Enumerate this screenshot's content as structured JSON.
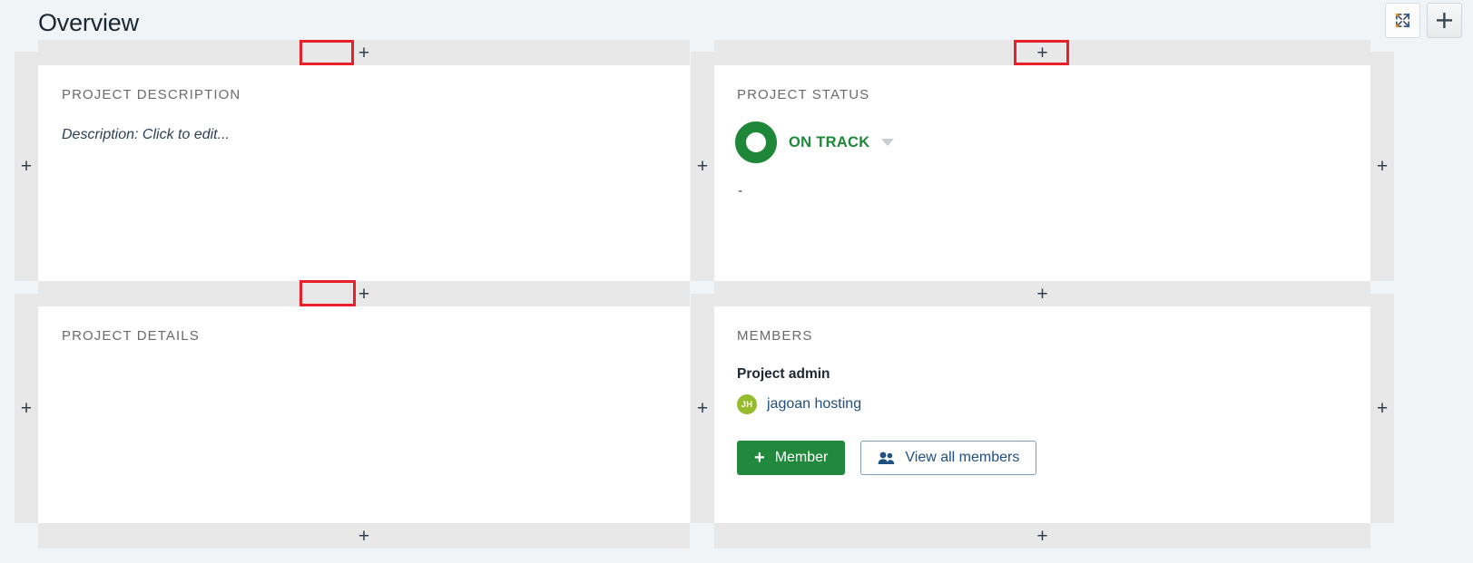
{
  "header": {
    "title": "Overview",
    "buttons": [
      {
        "name": "expand-icon",
        "label": "Expand"
      },
      {
        "name": "add-icon",
        "label": "Add"
      }
    ]
  },
  "gutters": {
    "add_label": "+"
  },
  "cards": {
    "description": {
      "title": "PROJECT DESCRIPTION",
      "placeholder": "Description: Click to edit..."
    },
    "status": {
      "title": "PROJECT STATUS",
      "value": "ON TRACK",
      "note": "-",
      "color": "#1e8739"
    },
    "details": {
      "title": "PROJECT DETAILS"
    },
    "members": {
      "title": "MEMBERS",
      "role_label": "Project admin",
      "admin": {
        "initials": "JH",
        "name": "jagoan hosting",
        "avatar_color": "#96bb2c"
      },
      "add_member_button": "Member",
      "add_member_icon": "+",
      "view_all_button": "View all members"
    }
  },
  "colors": {
    "accent_green": "#22883d",
    "link_blue": "#205081",
    "annotation_red": "#e8202a",
    "page_background": "#f1f4f7",
    "gutter_gray": "#e8e8e8"
  }
}
